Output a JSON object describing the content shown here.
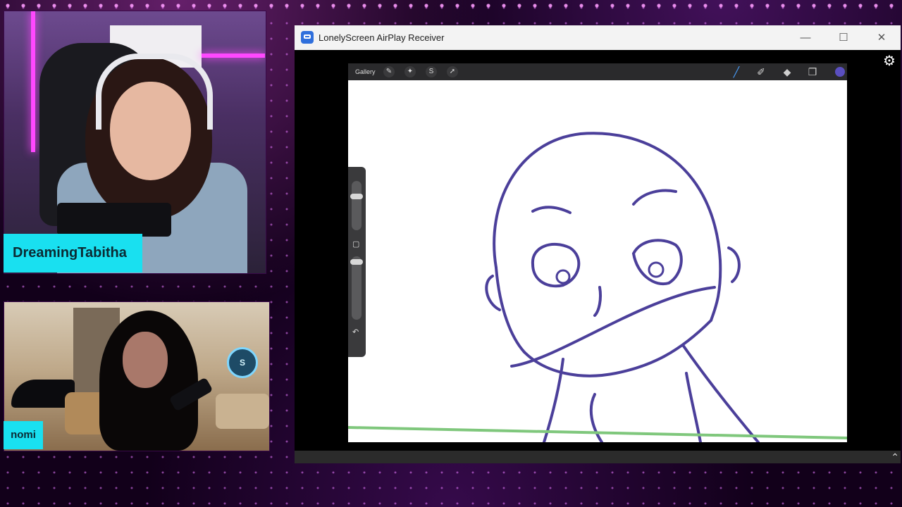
{
  "streamers": [
    {
      "name": "DreamingTabitha"
    },
    {
      "name": "nomi"
    }
  ],
  "window": {
    "title": "LonelyScreen AirPlay Receiver",
    "minimize_icon": "minimize-icon",
    "maximize_icon": "maximize-icon",
    "close_icon": "close-icon"
  },
  "procreate": {
    "gallery_label": "Gallery",
    "tools": [
      "wrench-icon",
      "magic-wand-icon",
      "selection-icon",
      "transform-icon"
    ],
    "right_tools": [
      "brush-icon",
      "smudge-icon",
      "eraser-icon",
      "layers-icon"
    ],
    "color": "#5a4fc0",
    "stroke_color": "#4b3f9a"
  },
  "accent_colors": {
    "nameplate": "#19e0f0",
    "background": "#12001a",
    "neon": "#ff48ff"
  }
}
